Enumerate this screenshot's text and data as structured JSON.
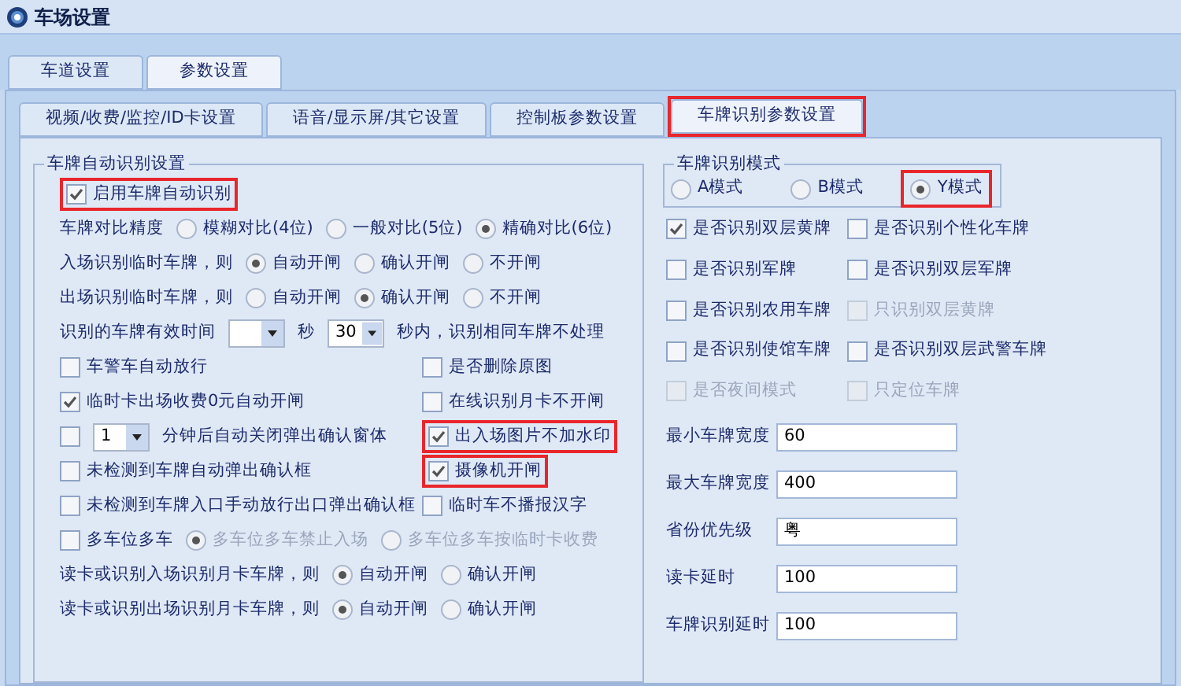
{
  "window": {
    "title": "车场设置"
  },
  "tabs": [
    {
      "label": "车道设置",
      "selected": false
    },
    {
      "label": "参数设置",
      "selected": true
    }
  ],
  "sub_tabs": [
    {
      "label": "视频/收费/监控/ID卡设置",
      "selected": false
    },
    {
      "label": "语音/显示屏/其它设置",
      "selected": false
    },
    {
      "label": "控制板参数设置",
      "selected": false
    },
    {
      "label": "车牌识别参数设置",
      "selected": true,
      "highlighted": true
    }
  ],
  "auto_group": {
    "title": "车牌自动识别设置",
    "rows": [
      {
        "items": [
          {
            "kind": "checkbox",
            "label": "启用车牌自动识别",
            "checked": true,
            "highlighted": true
          }
        ]
      },
      {
        "items": [
          {
            "kind": "text",
            "label": "车牌对比精度"
          },
          {
            "kind": "radio",
            "label": "模糊对比(4位)",
            "selected": false
          },
          {
            "kind": "radio",
            "label": "一般对比(5位)",
            "selected": false
          },
          {
            "kind": "radio",
            "label": "精确对比(6位)",
            "selected": true
          }
        ]
      },
      {
        "items": [
          {
            "kind": "text",
            "label": "入场识别临时车牌，则"
          },
          {
            "kind": "radio",
            "label": "自动开闸",
            "selected": true
          },
          {
            "kind": "radio",
            "label": "确认开闸",
            "selected": false
          },
          {
            "kind": "radio",
            "label": "不开闸",
            "selected": false
          }
        ]
      },
      {
        "items": [
          {
            "kind": "text",
            "label": "出场识别临时车牌，则"
          },
          {
            "kind": "radio",
            "label": "自动开闸",
            "selected": false
          },
          {
            "kind": "radio",
            "label": "确认开闸",
            "selected": true
          },
          {
            "kind": "radio",
            "label": "不开闸",
            "selected": false
          }
        ]
      },
      {
        "items": [
          {
            "kind": "text",
            "label": "识别的车牌有效时间"
          },
          {
            "kind": "select"
          },
          {
            "kind": "text",
            "label": "秒"
          },
          {
            "kind": "select",
            "value": "30"
          },
          {
            "kind": "text",
            "label": "秒内，识别相同车牌不处理"
          }
        ]
      },
      {
        "items": [
          {
            "kind": "checkbox",
            "label": "车警车自动放行",
            "checked": false
          }
        ],
        "right": {
          "kind": "checkbox",
          "label": "是否删除原图",
          "checked": false
        }
      },
      {
        "items": [
          {
            "kind": "checkbox",
            "label": "临时卡出场收费0元自动开闸",
            "checked": true
          }
        ],
        "right": {
          "kind": "checkbox",
          "label": "在线识别月卡不开闸",
          "checked": false
        }
      },
      {
        "items": [
          {
            "kind": "checkbox",
            "checked": false
          },
          {
            "kind": "select",
            "value": "1"
          },
          {
            "kind": "text",
            "label": "分钟后自动关闭弹出确认窗体"
          }
        ],
        "right": {
          "kind": "checkbox",
          "label": "出入场图片不加水印",
          "checked": true,
          "highlighted": true
        }
      },
      {
        "items": [
          {
            "kind": "checkbox",
            "label": "未检测到车牌自动弹出确认框",
            "checked": false
          }
        ],
        "right": {
          "kind": "checkbox",
          "label": "摄像机开闸",
          "checked": true,
          "highlighted": true
        }
      },
      {
        "items": [
          {
            "kind": "checkbox",
            "label": "未检测到车牌入口手动放行出口弹出确认框",
            "checked": false
          }
        ],
        "right": {
          "kind": "checkbox",
          "label": "临时车不播报汉字",
          "checked": false
        }
      },
      {
        "items": [
          {
            "kind": "checkbox",
            "label": "多车位多车",
            "checked": false
          },
          {
            "kind": "radio",
            "label": "多车位多车禁止入场",
            "selected": true,
            "disabled": true
          },
          {
            "kind": "radio",
            "label": "多车位多车按临时卡收费",
            "selected": false,
            "disabled": true
          }
        ]
      },
      {
        "items": [
          {
            "kind": "text",
            "label": "读卡或识别入场识别月卡车牌，则"
          },
          {
            "kind": "radio",
            "label": "自动开闸",
            "selected": true
          },
          {
            "kind": "radio",
            "label": "确认开闸",
            "selected": false
          }
        ]
      },
      {
        "items": [
          {
            "kind": "text",
            "label": "读卡或识别出场识别月卡车牌，则"
          },
          {
            "kind": "radio",
            "label": "自动开闸",
            "selected": true
          },
          {
            "kind": "radio",
            "label": "确认开闸",
            "selected": false
          }
        ]
      }
    ]
  },
  "mode_group": {
    "title": "车牌识别模式",
    "options": [
      {
        "label": "A模式",
        "selected": false
      },
      {
        "label": "B模式",
        "selected": false
      },
      {
        "label": "Y模式",
        "selected": true,
        "highlighted": true
      }
    ]
  },
  "plate_options": [
    {
      "label": "是否识别双层黄牌",
      "checked": true,
      "disabled": false
    },
    {
      "label": "是否识别个性化车牌",
      "checked": false,
      "disabled": false
    },
    {
      "label": "是否识别军牌",
      "checked": false,
      "disabled": false
    },
    {
      "label": "是否识别双层军牌",
      "checked": false,
      "disabled": false
    },
    {
      "label": "是否识别农用车牌",
      "checked": false,
      "disabled": false
    },
    {
      "label": "只识别双层黄牌",
      "checked": false,
      "disabled": true
    },
    {
      "label": "是否识别使馆车牌",
      "checked": false,
      "disabled": false
    },
    {
      "label": "是否识别双层武警车牌",
      "checked": false,
      "disabled": false
    },
    {
      "label": "是否夜间模式",
      "checked": false,
      "disabled": true
    },
    {
      "label": "只定位车牌",
      "checked": false,
      "disabled": true
    }
  ],
  "fields": [
    {
      "label": "最小车牌宽度",
      "value": "60"
    },
    {
      "label": "最大车牌宽度",
      "value": "400"
    },
    {
      "label": "省份优先级",
      "value": "粤"
    },
    {
      "label": "读卡延时",
      "value": "100"
    },
    {
      "label": "车牌识别延时",
      "value": "100"
    }
  ]
}
